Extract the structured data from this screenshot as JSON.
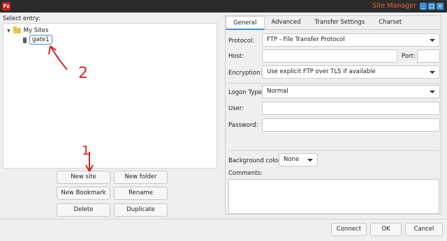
{
  "window": {
    "app_icon_text": "Fz",
    "title": "Site Manager",
    "title_color": "#e8642b",
    "controls": [
      "minimize",
      "maximize",
      "close"
    ]
  },
  "left": {
    "select_entry_label": "Select entry:",
    "tree": {
      "root_label": "My Sites",
      "site_label": "gate1"
    },
    "buttons": {
      "new_site": "New site",
      "new_folder": "New folder",
      "new_bookmark": "New Bookmark",
      "rename": "Rename",
      "delete": "Delete",
      "duplicate": "Duplicate"
    }
  },
  "tabs": [
    "General",
    "Advanced",
    "Transfer Settings",
    "Charset"
  ],
  "active_tab": "General",
  "general": {
    "protocol_label": "Protocol:",
    "protocol_value": "FTP - File Transfer Protocol",
    "host_label": "Host:",
    "host_value": "",
    "port_label": "Port:",
    "port_value": "",
    "encryption_label": "Encryption:",
    "encryption_value": "Use explicit FTP over TLS if available",
    "logon_type_label": "Logon Type:",
    "logon_type_value": "Normal",
    "user_label": "User:",
    "user_value": "",
    "password_label": "Password:",
    "password_value": "",
    "background_color_label": "Background color:",
    "background_color_value": "None",
    "comments_label": "Comments:",
    "comments_value": ""
  },
  "footer_buttons": {
    "connect": "Connect",
    "ok": "OK",
    "cancel": "Cancel"
  },
  "annotations": {
    "arrow_1_label": "1",
    "arrow_2_label": "2",
    "color": "#e0201c"
  },
  "accent_color": "#3f8fd8"
}
